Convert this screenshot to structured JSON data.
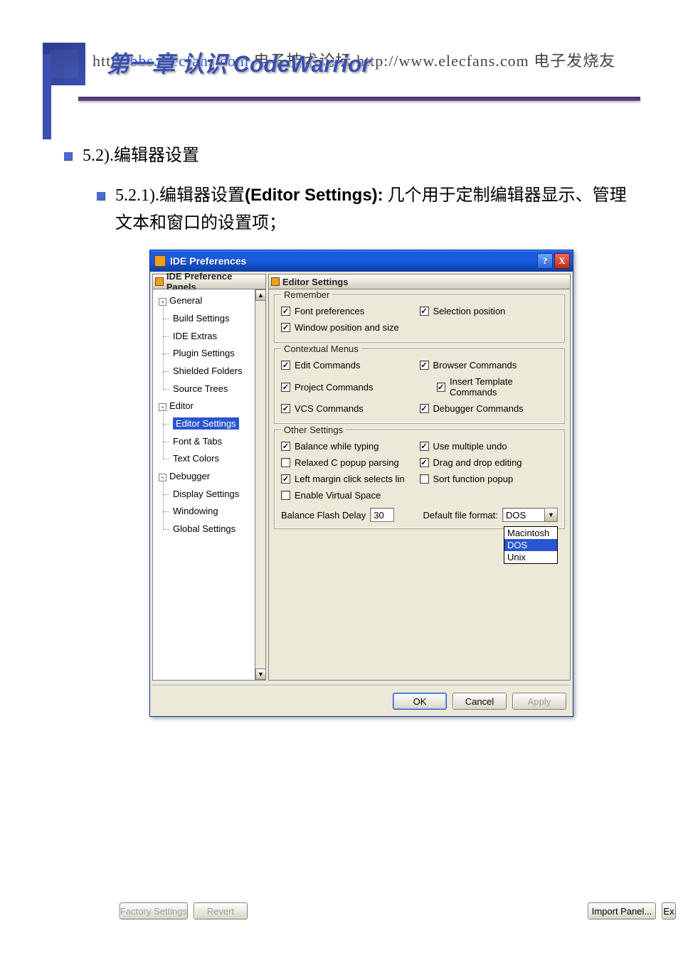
{
  "header": {
    "watermark_prefix": "http",
    "watermark_link1": "//bbs.elecfans.com",
    "watermark_mid": " 电子技术论坛 ",
    "watermark_link2_label": "http://www.elecfans.com",
    "watermark_suffix": " 电子发烧友",
    "slide_title": "第一章 认识 CodeWarrior"
  },
  "bullets": {
    "b52": "5.2).编辑器设置",
    "b521_num": "5.2.1).编辑器设置",
    "b521_bold": "(Editor Settings):",
    "b521_rest": " 几个用于定制编辑器显示、管理文本和窗口的设置项；"
  },
  "dialog": {
    "title": "IDE Preferences",
    "help": "?",
    "close": "X",
    "left_header": "IDE Preference Panels",
    "right_header": "Editor Settings",
    "tree": {
      "general": "General",
      "build_settings": "Build Settings",
      "ide_extras": "IDE Extras",
      "plugin_settings": "Plugin Settings",
      "shielded_folders": "Shielded Folders",
      "source_trees": "Source Trees",
      "editor": "Editor",
      "editor_settings": "Editor Settings",
      "font_tabs": "Font & Tabs",
      "text_colors": "Text Colors",
      "debugger": "Debugger",
      "display_settings": "Display Settings",
      "windowing": "Windowing",
      "global_settings": "Global Settings"
    },
    "groups": {
      "remember": "Remember",
      "contextual": "Contextual Menus",
      "other": "Other Settings"
    },
    "checks_remember": {
      "font_pref": "Font preferences",
      "selection_pos": "Selection position",
      "window_pos": "Window position and size"
    },
    "checks_contextual": {
      "edit_cmds": "Edit Commands",
      "browser_cmds": "Browser Commands",
      "project_cmds": "Project Commands",
      "insert_tpl": "Insert Template Commands",
      "vcs_cmds": "VCS Commands",
      "debugger_cmds": "Debugger Commands"
    },
    "checks_other": {
      "balance_typing": "Balance while typing",
      "multiple_undo": "Use multiple undo",
      "relaxed_c": "Relaxed C popup parsing",
      "drag_drop": "Drag and drop editing",
      "left_margin": "Left margin click selects lin",
      "sort_fn": "Sort function popup",
      "virtual_space": "Enable Virtual Space"
    },
    "fields": {
      "balance_flash_label": "Balance Flash Delay",
      "balance_flash_value": "30",
      "default_file_fmt_label": "Default file format:",
      "default_file_fmt_value": "DOS"
    },
    "droplist": {
      "macintosh": "Macintosh",
      "dos": "DOS",
      "unix": "Unix"
    },
    "buttons": {
      "factory": "Factory Settings",
      "revert": "Revert",
      "import": "Import Panel...",
      "export_prefix": "Ex",
      "ok": "OK",
      "cancel": "Cancel",
      "apply": "Apply"
    }
  }
}
